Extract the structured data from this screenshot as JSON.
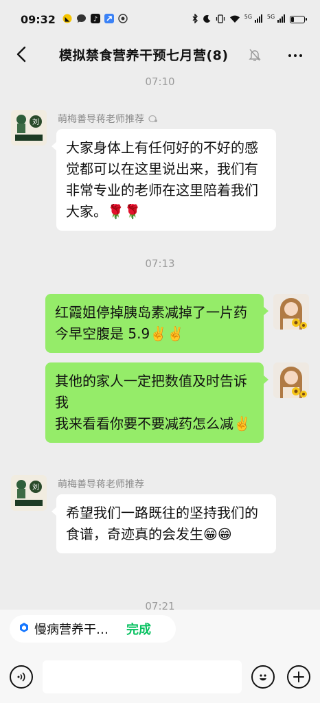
{
  "status_bar": {
    "time": "09:32",
    "network_labels": [
      "5G",
      "5G"
    ],
    "battery_level": 0.25
  },
  "header": {
    "title": "模拟禁食营养干预七月营(8)"
  },
  "timestamps": [
    "07:10",
    "07:13",
    "07:21"
  ],
  "messages": {
    "m1": {
      "sender": "萌梅善导蒋老师推荐",
      "text": "大家身体上有任何好的不好的感觉都可以在这里说出来，我们有非常专业的老师在这里陪着我们大家。🌹🌹",
      "avatar_text": "驰水长刘"
    },
    "m2": {
      "text": "红霞姐停掉胰岛素减掉了一片药今早空腹是 5.9✌️✌️"
    },
    "m3": {
      "text_line1": "其他的家人一定把数值及时告诉我",
      "text_line2": "我来看看你要不要减药怎么减✌️"
    },
    "m4": {
      "sender": "萌梅善导蒋老师推荐",
      "text": "希望我们一路既往的坚持我们的食谱，奇迹真的会发生😁😁",
      "avatar_text": "驰水长刘"
    }
  },
  "mini_program": {
    "name": "慢病营养干…",
    "done_label": "完成"
  },
  "input": {
    "placeholder": ""
  },
  "colors": {
    "bg": "#ededed",
    "green_bubble": "#95ec69",
    "done_green": "#07c160"
  }
}
